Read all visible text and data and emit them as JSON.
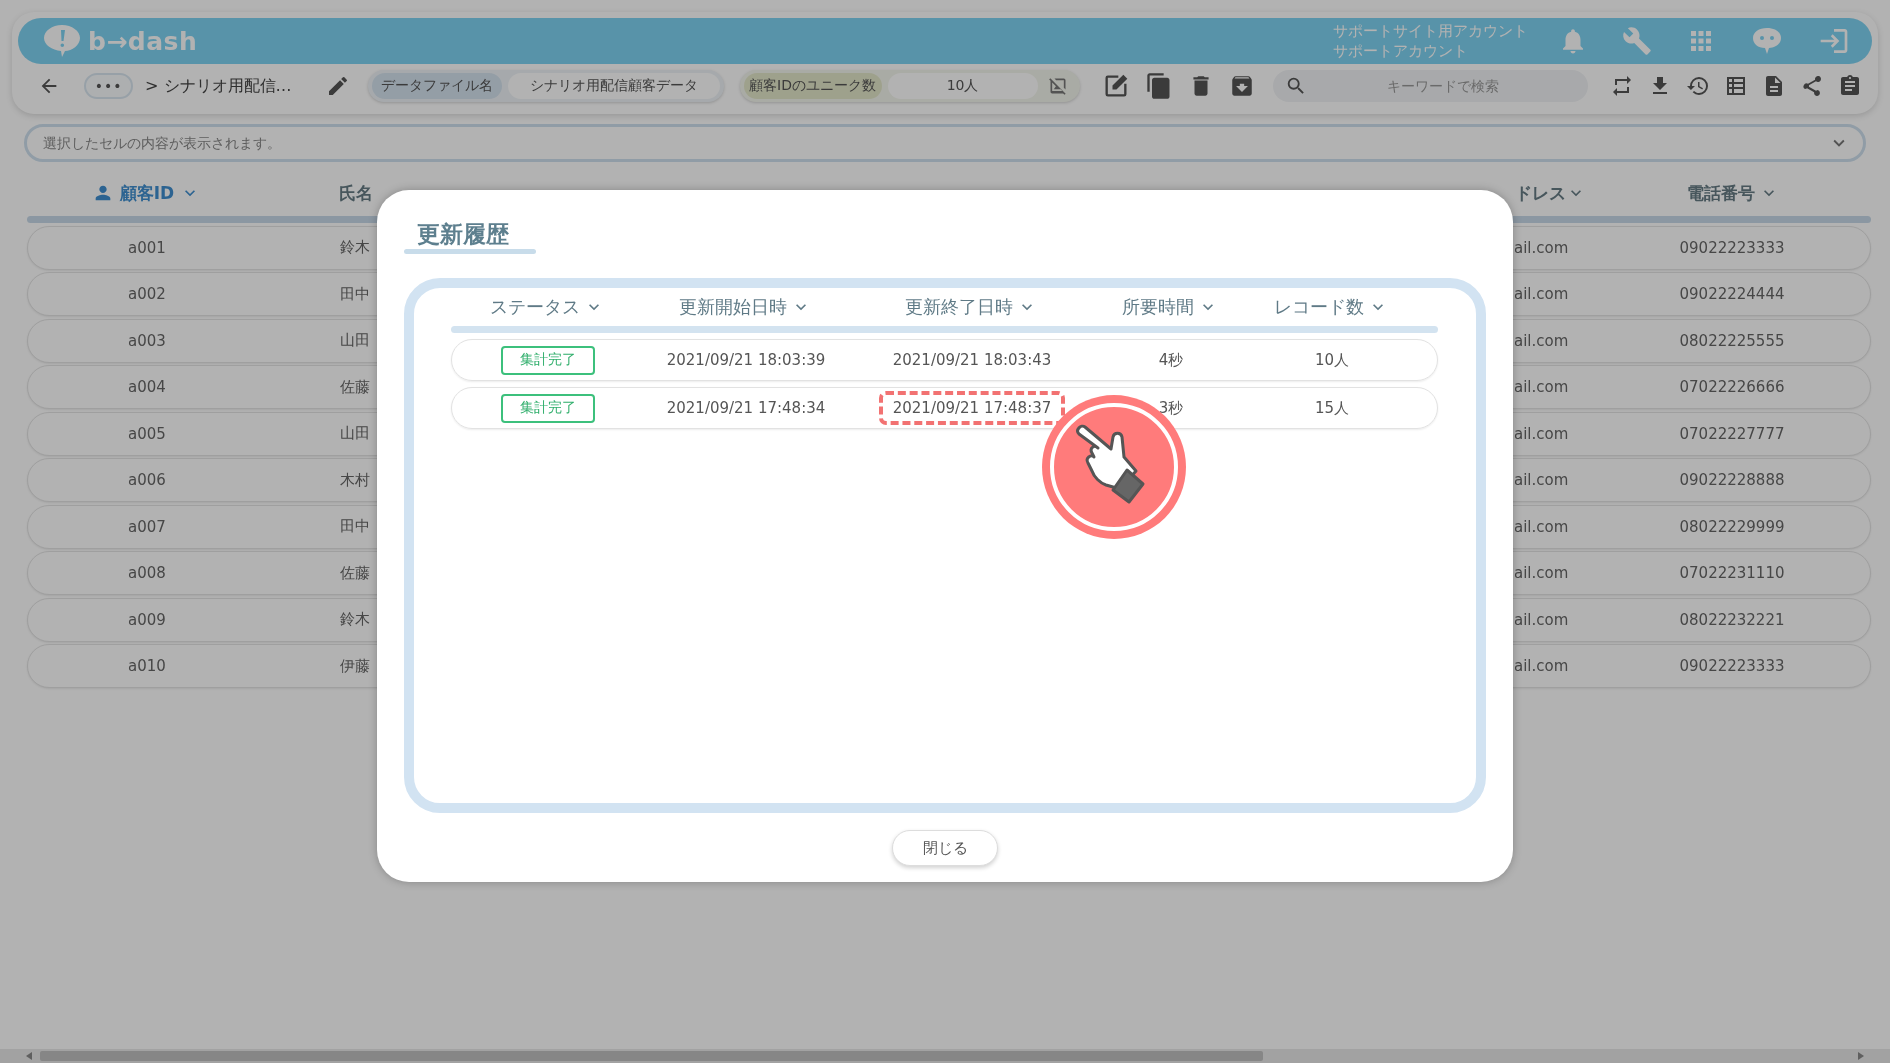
{
  "header": {
    "logo_text": "b→dash",
    "account_lines": [
      "サポートサイト用アカウント",
      "サポートアカウント"
    ]
  },
  "toolbar": {
    "more": "•••",
    "breadcrumb": "> シナリオ用配信…",
    "file_label": "データファイル名",
    "file_name": "シナリオ用配信顧客データ",
    "metric_label": "顧客IDのユニーク数",
    "metric_value": "10人",
    "search": {
      "placeholder": "キーワードで検索"
    }
  },
  "cell_viewer": {
    "placeholder": "選択したセルの内容が表示されます。"
  },
  "table": {
    "columns": [
      {
        "label": "顧客ID",
        "kind": "key"
      },
      {
        "label": "氏名",
        "kind": "plain"
      },
      {
        "label": "ドレス",
        "kind": "sortable"
      },
      {
        "label": "電話番号",
        "kind": "sortable"
      }
    ],
    "rows": [
      [
        "a001",
        "鈴木",
        "ail.com",
        "09022223333"
      ],
      [
        "a002",
        "田中",
        "ail.com",
        "09022224444"
      ],
      [
        "a003",
        "山田",
        "ail.com",
        "08022225555"
      ],
      [
        "a004",
        "佐藤",
        "ail.com",
        "07022226666"
      ],
      [
        "a005",
        "山田",
        "ail.com",
        "07022227777"
      ],
      [
        "a006",
        "木村",
        "ail.com",
        "09022228888"
      ],
      [
        "a007",
        "田中",
        "ail.com",
        "08022229999"
      ],
      [
        "a008",
        "佐藤",
        "ail.com",
        "07022231110"
      ],
      [
        "a009",
        "鈴木",
        "ail.com",
        "08022232221"
      ],
      [
        "a010",
        "伊藤",
        "ail.com",
        "09022223333"
      ]
    ]
  },
  "dialog": {
    "title": "更新履歴",
    "columns": [
      "ステータス",
      "更新開始日時",
      "更新終了日時",
      "所要時間",
      "レコード数"
    ],
    "rows": [
      {
        "status": "集計完了",
        "start": "2021/09/21 18:03:39",
        "end": "2021/09/21 18:03:43",
        "end_highlighted": false,
        "duration": "4秒",
        "records": "10人"
      },
      {
        "status": "集計完了",
        "start": "2021/09/21 17:48:34",
        "end": "2021/09/21 17:48:37",
        "end_highlighted": true,
        "duration": "3秒",
        "records": "15人"
      }
    ],
    "close_label": "閉じる"
  }
}
